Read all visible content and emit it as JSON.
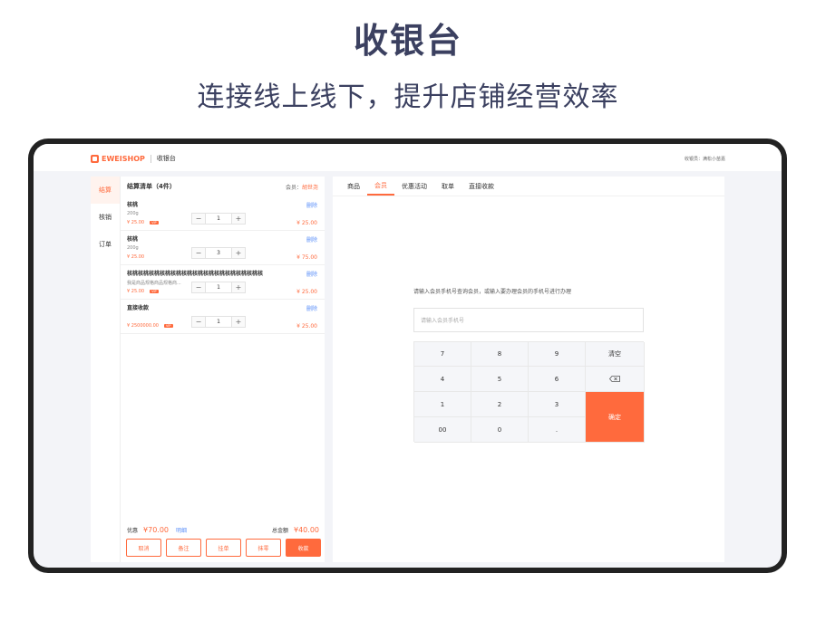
{
  "hero": {
    "title": "收银台",
    "subtitle": "连接线上线下，提升店铺经营效率"
  },
  "topbar": {
    "brand": "EWEISHOP",
    "page": "收银台",
    "cashier": "收银员：满松小苗嘉"
  },
  "sidebar": {
    "items": [
      {
        "label": "结算"
      },
      {
        "label": "核销"
      },
      {
        "label": "订单"
      }
    ]
  },
  "cart": {
    "title": "结算清单（4件）",
    "member_label": "会员：",
    "member_name": "胡世尧",
    "items": [
      {
        "name": "核桃",
        "spec": "200g",
        "price": "¥ 25.00",
        "vip": "VIP",
        "qty": "1",
        "subtotal": "¥ 25.00",
        "delete": "删除"
      },
      {
        "name": "核桃",
        "spec": "200g",
        "price": "¥ 25.00",
        "vip": "",
        "qty": "3",
        "subtotal": "¥ 75.00",
        "delete": "删除"
      },
      {
        "name": "核桃核桃核桃核桃核桃核桃核桃核桃核桃核桃核桃核桃核...",
        "spec": "我是商品规格商品规格商...",
        "price": "¥ 25.00",
        "vip": "VIP",
        "qty": "1",
        "subtotal": "¥ 25.00",
        "delete": "删除"
      },
      {
        "name": "直接收款",
        "spec": "",
        "price": "¥ 2500000.00",
        "vip": "VIP",
        "qty": "1",
        "subtotal": "¥ 25.00",
        "delete": "删除"
      }
    ],
    "discount_label": "优惠",
    "discount_amount": "¥70.00",
    "discount_link": "明细",
    "total_label": "总金额",
    "total_amount": "¥40.00",
    "actions": [
      "取消",
      "备注",
      "挂单",
      "抹零",
      "收款"
    ]
  },
  "panel": {
    "tabs": [
      "商品",
      "会员",
      "优惠活动",
      "取单",
      "直接收款"
    ],
    "active_tab": "会员",
    "hint": "请输入会员手机号查询会员，或输入要办理会员的手机号进行办理",
    "phone_placeholder": "请输入会员手机号",
    "keys": [
      "7",
      "8",
      "9",
      "清空",
      "4",
      "5",
      "6",
      "1",
      "2",
      "3",
      "00",
      "0",
      "."
    ],
    "confirm": "确定"
  },
  "colors": {
    "accent": "#ff6a3d",
    "link": "#5b8ff9",
    "heading": "#3b4060"
  }
}
